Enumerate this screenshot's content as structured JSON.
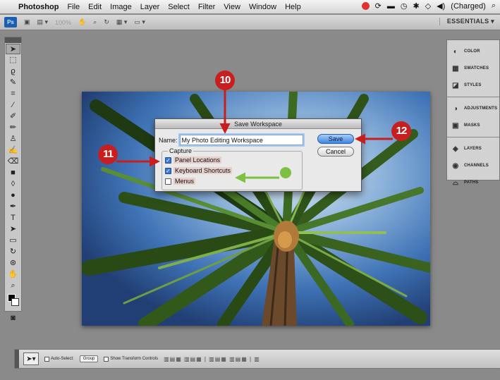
{
  "menubar": {
    "apple_glyph": "",
    "app_name": "Photoshop",
    "items": [
      "File",
      "Edit",
      "Image",
      "Layer",
      "Select",
      "Filter",
      "View",
      "Window",
      "Help"
    ],
    "battery_label": "(Charged)"
  },
  "appbar": {
    "ps_label": "Ps",
    "zoom_label": "100%",
    "workspace_label": "ESSENTIALS ▾"
  },
  "panels": {
    "group1": [
      "COLOR",
      "SWATCHES",
      "STYLES"
    ],
    "group2": [
      "ADJUSTMENTS",
      "MASKS"
    ],
    "group3": [
      "LAYERS",
      "CHANNELS",
      "PATHS"
    ]
  },
  "dialog": {
    "title": "Save Workspace",
    "name_label": "Name:",
    "name_value": "My Photo Editing Workspace",
    "capture_legend": "Capture",
    "checkboxes": [
      {
        "label": "Panel Locations",
        "checked": true
      },
      {
        "label": "Keyboard Shortcuts",
        "checked": true
      },
      {
        "label": "Menus",
        "checked": false
      }
    ],
    "save_label": "Save",
    "cancel_label": "Cancel"
  },
  "options": {
    "auto_select_label": "Auto-Select:",
    "group_select": "Group",
    "transform_label": "Show Transform Controls"
  },
  "callouts": {
    "c10": "10",
    "c11": "11",
    "c12": "12"
  },
  "colors": {
    "callout_red": "#c71f1f",
    "indicator_green": "#7dc142",
    "accent_blue": "#3b78d4"
  }
}
